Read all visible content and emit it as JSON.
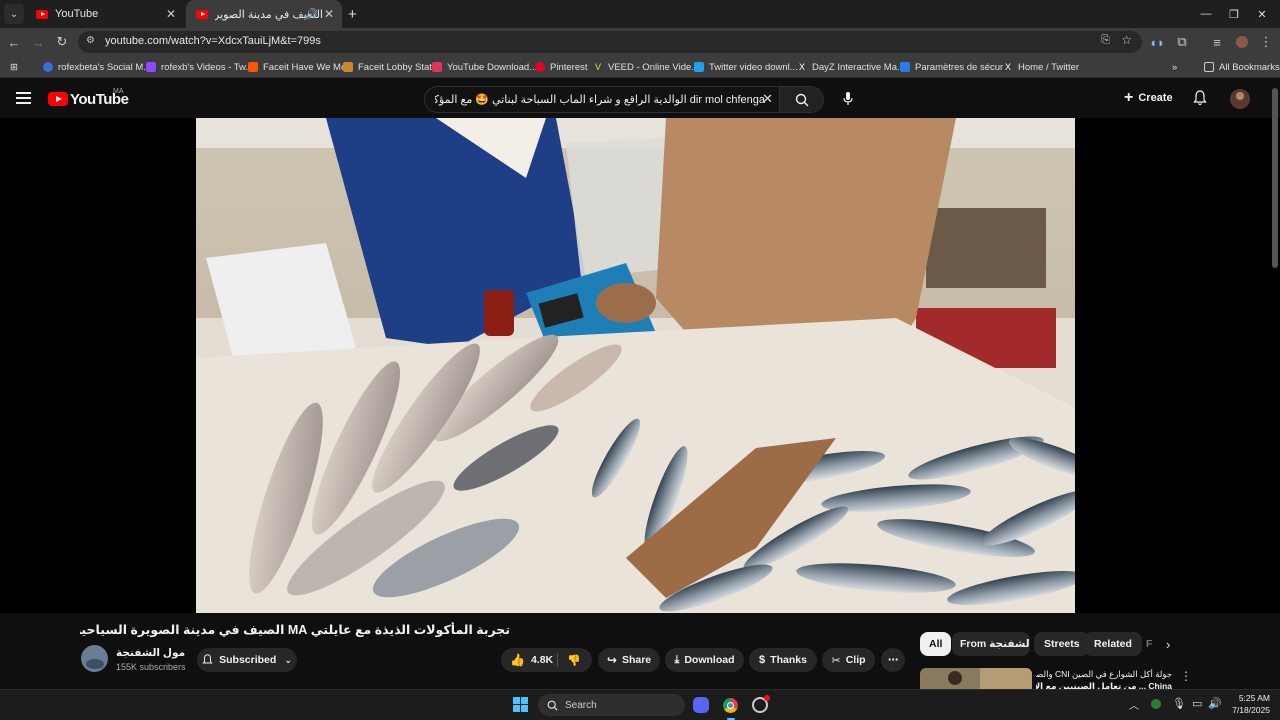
{
  "browser": {
    "tabs": [
      {
        "title": "YouTube"
      },
      {
        "title": "الصيف في مدينة الصويرة ال..."
      }
    ],
    "url": "youtube.com/watch?v=XdcxTauiLjM&t=799s",
    "bookmarks": [
      "rofexbeta's Social M...",
      "rofexb's Videos - Tw...",
      "Faceit Have We Met",
      "Faceit Lobby Stats",
      "YouTube Download...",
      "Pinterest",
      "VEED - Online Vide...",
      "Twitter video downl...",
      "DayZ Interactive Ma...",
      "Paramètres de sécur...",
      "Home / Twitter"
    ],
    "all_bookmarks": "All Bookmarks"
  },
  "youtube": {
    "logo_text": "YouTube",
    "country": "MA",
    "search_query": "dir mol chfenga الوالدية الراقع و شراء الماب السباحة لبناتي 🤩 مع المؤكولات الشهية 🇲🇦",
    "create_label": "Create"
  },
  "video": {
    "title": "تجربة المأكولات الذيذة مع عايلتي MA الصيف في مدينة الصويرة السياحية من أجمل البحور ...",
    "channel": "مول الشفنجة",
    "subscribers": "155K subscribers",
    "subscribed_label": "Subscribed",
    "likes": "4.8K",
    "share_label": "Share",
    "download_label": "Download",
    "thanks_label": "Thanks",
    "clip_label": "Clip"
  },
  "sidebar": {
    "chips": [
      "All",
      "From مول الشفنجة",
      "Streets",
      "Related",
      "F"
    ],
    "rec_title": "جولة أكل الشوارع في الصين CNI والصدمت",
    "rec_title2": "China ... من تعامل الصينيين مع الأكل"
  },
  "taskbar": {
    "search_label": "Search",
    "time": "5:25 AM",
    "date": "7/18/2025"
  },
  "colors": {
    "yt_red": "#ff0000",
    "bg": "#0f0f0f",
    "chip_bg": "#272727"
  }
}
